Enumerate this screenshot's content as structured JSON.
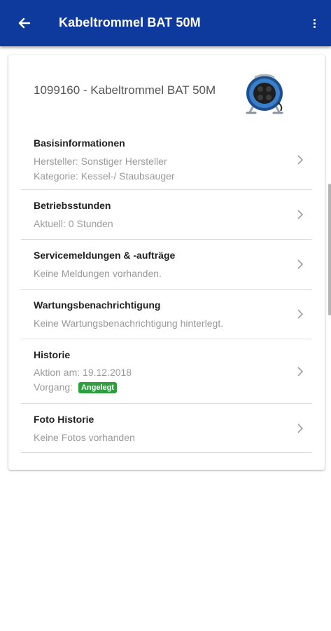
{
  "appbar": {
    "title": "Kabeltrommel BAT 50M"
  },
  "product": {
    "title": "1099160 - Kabeltrommel BAT 50M"
  },
  "sections": {
    "basis": {
      "title": "Basisinformationen",
      "line1": "Hersteller: Sonstiger Hersteller",
      "line2": "Kategorie: Kessel-/ Staubsauger"
    },
    "betrieb": {
      "title": "Betriebsstunden",
      "line1": "Aktuell: 0 Stunden"
    },
    "service": {
      "title": "Servicemeldungen & -aufträge",
      "line1": "Keine Meldungen vorhanden."
    },
    "wartung": {
      "title": "Wartungsbenachrichtigung",
      "line1": "Keine Wartungsbenachrichtigung hinterlegt."
    },
    "historie": {
      "title": "Historie",
      "line1": "Aktion am: 19.12.2018",
      "line2_label": "Vorgang:",
      "badge": "Angelegt"
    },
    "foto": {
      "title": "Foto Historie",
      "line1": "Keine Fotos vorhanden"
    }
  },
  "colors": {
    "appbar": "#0d3a9c",
    "badge": "#2e9e3e"
  },
  "icons": {
    "back": "arrow-left-icon",
    "more": "more-vertical-icon",
    "chevron": "chevron-right-icon"
  }
}
